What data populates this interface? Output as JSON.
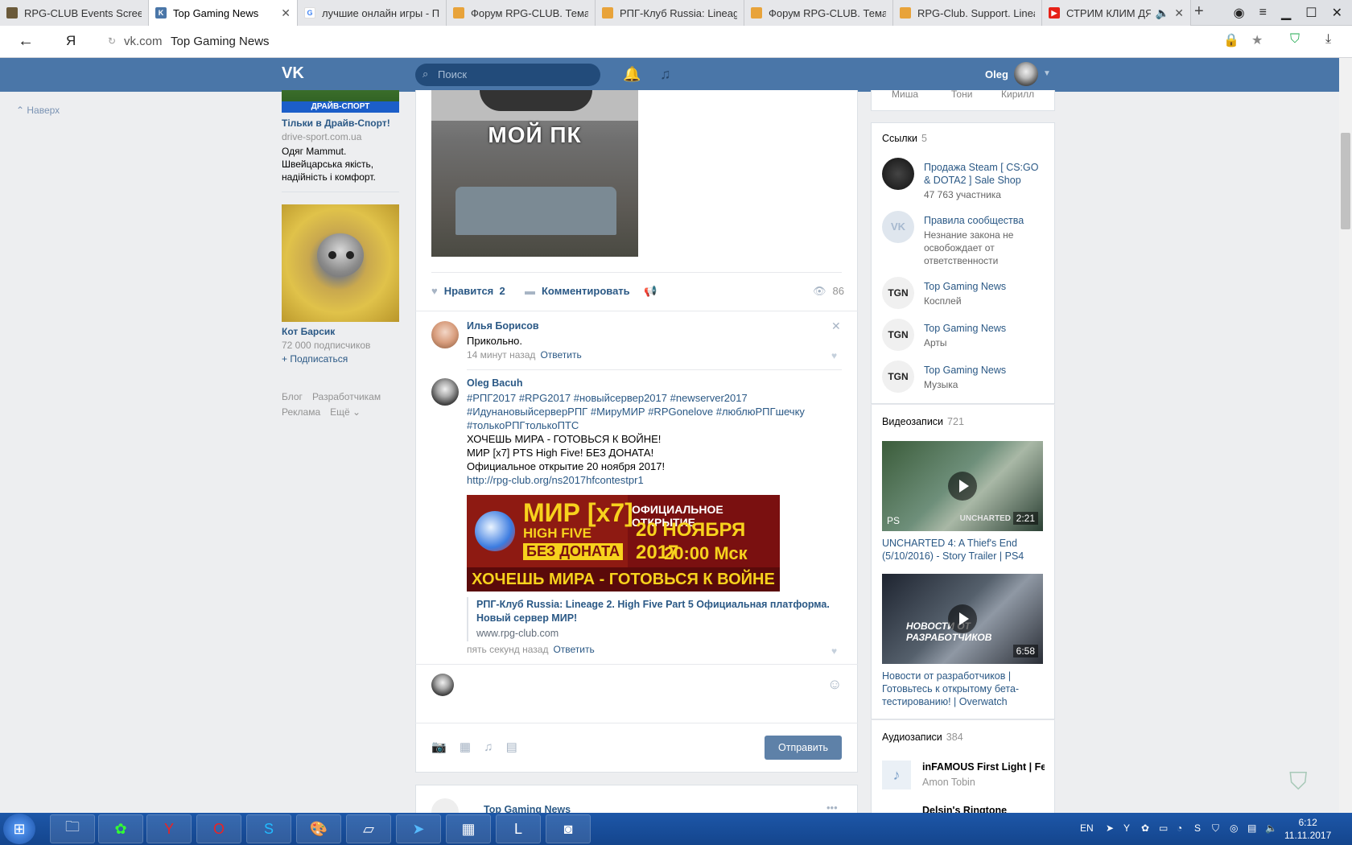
{
  "browser": {
    "tabs": [
      {
        "label": "RPG-CLUB Events Screens",
        "color": "#6b5a3a"
      },
      {
        "label": "Top Gaming News",
        "color": "#4a76a8",
        "active": true
      },
      {
        "label": "лучшие онлайн игры - По",
        "color": "#ffffff"
      },
      {
        "label": "Форум RPG-CLUB. Тема: !",
        "color": "#e8a33a"
      },
      {
        "label": "РПГ-Клуб Russia: Lineage",
        "color": "#e8a33a"
      },
      {
        "label": "Форум RPG-CLUB. Тема: !",
        "color": "#e8a33a"
      },
      {
        "label": "RPG-Club. Support. Lineag",
        "color": "#e8a33a"
      },
      {
        "label": "СТРИМ КЛИМ ДЯД",
        "color": "#e62117"
      }
    ],
    "new_tab": "+",
    "address_domain": "vk.com",
    "address_title": "Top Gaming News"
  },
  "vk_header": {
    "logo": "VK",
    "search_placeholder": "Поиск",
    "user_name": "Oleg"
  },
  "left": {
    "to_top": "Наверх",
    "ad1": {
      "banner": "ДРАЙВ-СПОРТ",
      "title": "Тільки в Драйв-Спорт!",
      "url": "drive-sport.com.ua",
      "text": "Одяг Mammut. Швейцарська якість, надійність і комфорт."
    },
    "ad2": {
      "title": "Кот Барсик",
      "subs": "72 000 подписчиков",
      "join": "+ Подписаться"
    },
    "footer": [
      "Блог",
      "Разработчикам",
      "Реклама",
      "Ещё ⌄"
    ]
  },
  "post": {
    "meme_caption": "МОЙ ПК",
    "like_label": "Нравится",
    "like_count": "2",
    "comment_label": "Комментировать",
    "views": "86"
  },
  "comments": [
    {
      "author": "Илья Борисов",
      "text": "Прикольно.",
      "time": "14 минут назад",
      "reply": "Ответить"
    },
    {
      "author": "Oleg Bacuh",
      "tags_line1": "#РПГ2017 #RPG2017 #новыйсервер2017 #newserver2017",
      "tags_line2": "#ИдунановыйсерверРПГ #МируМИР #RPGonelove #люблюРПГшечку",
      "tags_line3": "#толькоРПГтолькоПТС",
      "line4": "ХОЧЕШЬ МИРА - ГОТОВЬСЯ К ВОЙНЕ!",
      "line5": "МИР [x7] PTS High Five! БЕЗ ДОНАТА!",
      "line6": "Официальное открытие 20 ноября 2017!",
      "link": "http://rpg-club.org/ns2017hfcontestpr1",
      "banner": {
        "mir": "МИР [x7]",
        "hf": "HIGH FIVE",
        "nodonate": "БЕЗ ДОНАТА",
        "opening": "ОФИЦИАЛЬНОЕ ОТКРЫТИЕ",
        "date": "20 НОЯБРЯ 2017",
        "time": "20:00 Мск",
        "slogan": "ХОЧЕШЬ МИРА - ГОТОВЬСЯ К ВОЙНЕ"
      },
      "link_title": "РПГ-Клуб Russia: Lineage 2. High Five Part 5 Официальная платформа. Новый сервер МИР!",
      "link_domain": "www.rpg-club.com",
      "time": "пять секунд назад",
      "reply": "Ответить"
    }
  ],
  "reply_box": {
    "send": "Отправить"
  },
  "next_post": {
    "author": "Top Gaming News"
  },
  "right": {
    "members": [
      "Миша",
      "Тони",
      "Кирилл"
    ],
    "links_title": "Ссылки",
    "links_count": "5",
    "links": [
      {
        "title": "Продажа Steam [ CS:GO & DOTA2 ] Sale Shop",
        "sub": "47 763 участника"
      },
      {
        "title": "Правила сообщества",
        "sub": "Незнание закона не освобождает от ответственности"
      },
      {
        "title": "Top Gaming News",
        "sub": "Косплей"
      },
      {
        "title": "Top Gaming News",
        "sub": "Арты"
      },
      {
        "title": "Top Gaming News",
        "sub": "Музыка"
      }
    ],
    "videos_title": "Видеозаписи",
    "videos_count": "721",
    "videos": [
      {
        "title": "UNCHARTED 4: A Thief's End (5/10/2016) - Story Trailer | PS4",
        "duration": "2:21",
        "brand": "UNCHARTED"
      },
      {
        "title": "Новости от разработчиков | Готовьтесь к открытому бета-тестированию! | Overwatch",
        "duration": "6:58",
        "banner": "НОВОСТИ ОТ РАЗРАБОТЧИКОВ"
      }
    ],
    "audio_title": "Аудиозаписи",
    "audio_count": "384",
    "audio": [
      {
        "title": "inFAMOUS First Light | Fe...",
        "artist": "Amon Tobin"
      },
      {
        "title": "Delsin's Ringtone",
        "artist": ""
      }
    ]
  },
  "taskbar": {
    "lang": "EN",
    "time": "6:12",
    "date": "11.11.2017"
  }
}
